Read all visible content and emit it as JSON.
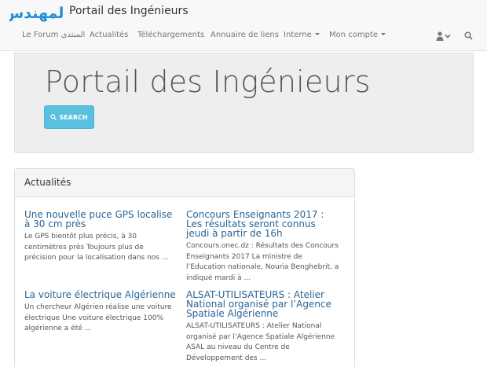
{
  "header": {
    "brand": "Portail des Ingénieurs",
    "logo_text": "المهندس",
    "nav": [
      {
        "label": "Le Forum المنتدى",
        "dropdown": false
      },
      {
        "label": "Actualités",
        "dropdown": false
      },
      {
        "label": "Téléchargements",
        "dropdown": false
      },
      {
        "label": "Annuaire de liens",
        "dropdown": false
      },
      {
        "label": "Interne",
        "dropdown": true
      },
      {
        "label": "Mon compte",
        "dropdown": true
      }
    ],
    "icons": [
      "user-icon",
      "chevron-down-icon",
      "search-icon"
    ]
  },
  "hero": {
    "title": "Portail des Ingénieurs",
    "search_label": "SEARCH"
  },
  "panel": {
    "heading": "Actualités",
    "articles": [
      {
        "title": "Une nouvelle puce GPS localise à 30 cm près",
        "excerpt": "Le GPS bientôt plus précis, à 30 centimètres près   Toujours plus de précision pour la localisation dans nos ..."
      },
      {
        "title": "Concours Enseignants 2017 : Les résultats seront connus jeudi à partir de 16h",
        "excerpt": "Concours.onec.dz : Résultats des Concours Enseignants 2017 La ministre de l’Education nationale, Nouria Benghebrit, a indiqué mardi à ..."
      },
      {
        "title": "La voiture électrique Algérienne",
        "excerpt": "Un chercheur Algérien réalise une voiture électrique Une voiture électrique 100% algérienne a été  ..."
      },
      {
        "title": "ALSAT-UTILISATEURS : Atelier National organisé par l’Agence Spatiale Algérienne",
        "excerpt": " ALSAT-UTILISATEURS : Atelier National organisé par l’Agence Spatiale Algérienne ASAL au niveau du Centre de Développement des ..."
      }
    ]
  },
  "colors": {
    "logo": "#1e90d6",
    "link": "#2a6496",
    "search_button": "#5bc0de"
  }
}
